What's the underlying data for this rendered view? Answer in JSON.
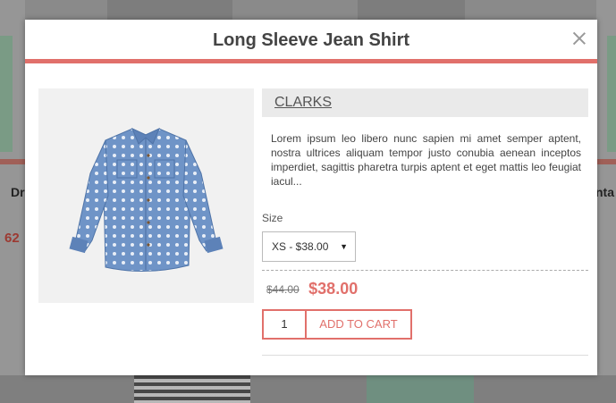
{
  "background": {
    "left_label": "Dr",
    "left_price": "62",
    "right_label": "nta"
  },
  "modal": {
    "title": "Long Sleeve Jean Shirt",
    "close_icon": "close-icon",
    "accent_color": "#e1706b",
    "product_image": "denim-polka-dot-shirt",
    "brand": "CLARKS",
    "description": "Lorem ipsum leo libero nunc sapien mi amet semper aptent, nostra ultrices aliquam tempor justo conubia aenean inceptos imperdiet, sagittis pharetra turpis aptent et eget mattis leo feugiat iacul...",
    "size_label": "Size",
    "size_selected": "XS - $38.00",
    "old_price": "$44.00",
    "new_price": "$38.00",
    "quantity": "1",
    "add_to_cart": "ADD TO CART"
  }
}
